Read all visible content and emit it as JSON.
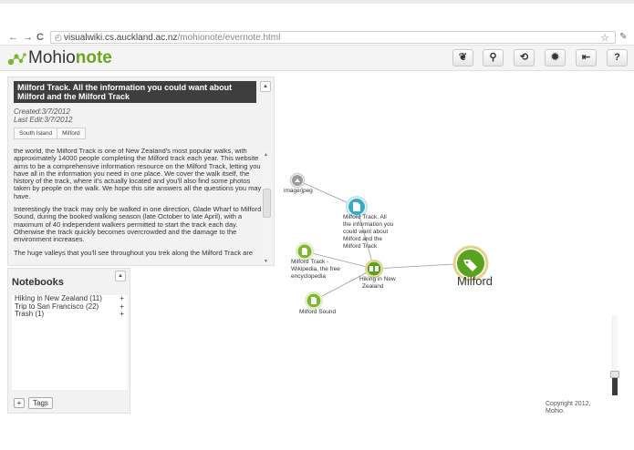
{
  "browser": {
    "back_glyph": "←",
    "forward_glyph": "→",
    "reload_glyph": "C",
    "url_host": "visualwiki.cs.auckland.ac.nz",
    "url_path": "/mohionote/evernote.html",
    "star_glyph": "☆",
    "wrench_glyph": "✎"
  },
  "app": {
    "logo_prefix": "Mohio",
    "logo_suffix": "note",
    "brand_color": "#6aa51e",
    "toolbar": [
      {
        "name": "evernote-button",
        "glyph": "❦"
      },
      {
        "name": "search-button",
        "glyph": "⚲"
      },
      {
        "name": "sync-button",
        "glyph": "⟲"
      },
      {
        "name": "settings-button",
        "glyph": "✹"
      },
      {
        "name": "logout-button",
        "glyph": "⇤"
      },
      {
        "name": "help-button",
        "glyph": "?"
      }
    ]
  },
  "note": {
    "title": "Milford Track. All the information you could want about Milford and the Milford Track",
    "created": "Created:3/7/2012",
    "last_edit": "Last Edit:3/7/2012",
    "collapse_glyph": "▲",
    "tags": [
      "South Island",
      "Milford"
    ],
    "paragraphs": [
      "the world, the Milford Track is one of New Zealand's most popular walks, with approximately 14000 people completing the Milford track each year. This website aims to be a comprehensive information resource on the Milford Track, letting you have all in the information you need in one place. We cover the walk itself, the history of the track, where it's actually located and you'll also find some photos taken by people on the walk. We hope this site answers all the questions you may have.",
      "Interestingly the track may only be walked in one direction, Glade Wharf to Milford Sound, during the booked walking season (late October to late April), with a maximum of 40 independent walkers permitted to start the track each day. Otherwise the track quickly becomes overcrowded and the damage to the environment increases.",
      "The huge valleys that you'll see throughout you trek along the Milford Track are"
    ]
  },
  "notebooks": {
    "title": "Notebooks",
    "collapse_glyph": "▲",
    "items": [
      {
        "label": "Hiking in New Zealand (11)",
        "action": "+"
      },
      {
        "label": "Trip to San Francisco (22)",
        "action": "+"
      },
      {
        "label": "Trash (1)",
        "action": "+"
      }
    ],
    "add_label": "+",
    "tags_label": "Tags"
  },
  "graph": {
    "nodes": {
      "image": {
        "label": "image/jpeg"
      },
      "milford_track_note": {
        "label_lines": [
          "Milford Track. All",
          "the information you",
          "could want about",
          "Milford and the",
          "Milford Track"
        ]
      },
      "wikipedia": {
        "label_lines": [
          "Milford Track -",
          "Wikipedia, the free",
          "encyclopedia"
        ]
      },
      "hiking": {
        "label_lines": [
          "Hiking in New",
          "Zealand"
        ]
      },
      "milford_sound": {
        "label": "Milford Sound"
      },
      "milford_tag": {
        "label": "Milford"
      }
    },
    "colors": {
      "note_blue": "#3aa9c8",
      "note_green": "#7cb82b",
      "tag_green": "#5aa21e",
      "tag_ring": "#e2d28c",
      "image_gray": "#9a9a9a"
    }
  },
  "footer": {
    "copyright_lines": [
      "Copyright 2012,",
      "Mohio."
    ]
  }
}
